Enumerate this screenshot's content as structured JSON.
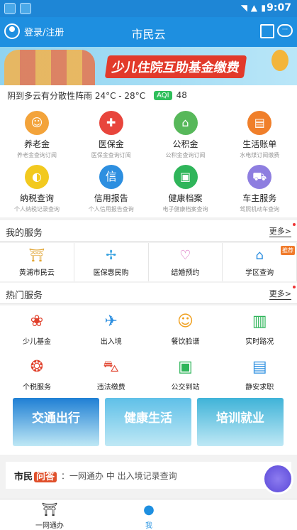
{
  "status": {
    "time": "9:07"
  },
  "header": {
    "login": "登录/注册",
    "title": "市民云"
  },
  "banner": {
    "text": "少儿住院互助基金缴费"
  },
  "weather": {
    "text": "阴到多云有分散性阵雨 24°C - 28°C",
    "aqi_label": "AQI",
    "aqi_value": "48"
  },
  "grid": [
    {
      "label": "养老金",
      "sub": "养老金查询订阅",
      "color": "#f3a33a",
      "glyph": "☺"
    },
    {
      "label": "医保金",
      "sub": "医保金查询订阅",
      "color": "#e8453c",
      "glyph": "✚"
    },
    {
      "label": "公积金",
      "sub": "公积金查询订阅",
      "color": "#57b85a",
      "glyph": "⌂"
    },
    {
      "label": "生活账单",
      "sub": "水电煤订阅缴费",
      "color": "#f07f2a",
      "glyph": "▤"
    },
    {
      "label": "纳税查询",
      "sub": "个人纳税记录查询",
      "color": "#f2c91f",
      "glyph": "◐"
    },
    {
      "label": "信用报告",
      "sub": "个人信用报告查询",
      "color": "#2d8fe0",
      "glyph": "信"
    },
    {
      "label": "健康档案",
      "sub": "电子健康档案查询",
      "color": "#2fb55a",
      "glyph": "▣"
    },
    {
      "label": "车主服务",
      "sub": "驾照机动车查询",
      "color": "#8e7ee0",
      "glyph": "⛟"
    }
  ],
  "my_services": {
    "title": "我的服务",
    "more": "更多>",
    "items": [
      {
        "label": "黄浦市民云",
        "glyph": "⛩",
        "color": "#e0a330"
      },
      {
        "label": "医保惠民购",
        "glyph": "✢",
        "color": "#3aa3e0"
      },
      {
        "label": "结婚预约",
        "glyph": "♡",
        "color": "#d65bb8"
      },
      {
        "label": "学区查询",
        "glyph": "⌂",
        "color": "#2d8fe0",
        "badge": "推荐"
      }
    ]
  },
  "hot_services": {
    "title": "热门服务",
    "more": "更多>",
    "items": [
      {
        "label": "少儿基金",
        "glyph": "❀",
        "color": "#e0402b"
      },
      {
        "label": "出入境",
        "glyph": "✈",
        "color": "#2d8fe0"
      },
      {
        "label": "餐饮脸谱",
        "glyph": "☺",
        "color": "#f0a020"
      },
      {
        "label": "实时路况",
        "glyph": "▥",
        "color": "#2fb55a"
      },
      {
        "label": "个税服务",
        "glyph": "❂",
        "color": "#e0402b"
      },
      {
        "label": "违法缴费",
        "glyph": "⛍",
        "color": "#e0402b"
      },
      {
        "label": "公交到站",
        "glyph": "▣",
        "color": "#2fb55a"
      },
      {
        "label": "静安求职",
        "glyph": "▤",
        "color": "#2d8fe0"
      }
    ]
  },
  "tiles": [
    {
      "label": "交通出行",
      "color": "#1f7fd4"
    },
    {
      "label": "健康生活",
      "color": "#5fc0e8"
    },
    {
      "label": "培训就业",
      "color": "#3fb3d8"
    }
  ],
  "ask": {
    "logo_a": "市民",
    "logo_b": "问答",
    "text": "：一网通办 中 出入境记录查询"
  },
  "tabs": [
    {
      "label": "一网通办",
      "glyph": "⛩"
    },
    {
      "label": "我",
      "glyph": "●"
    }
  ]
}
